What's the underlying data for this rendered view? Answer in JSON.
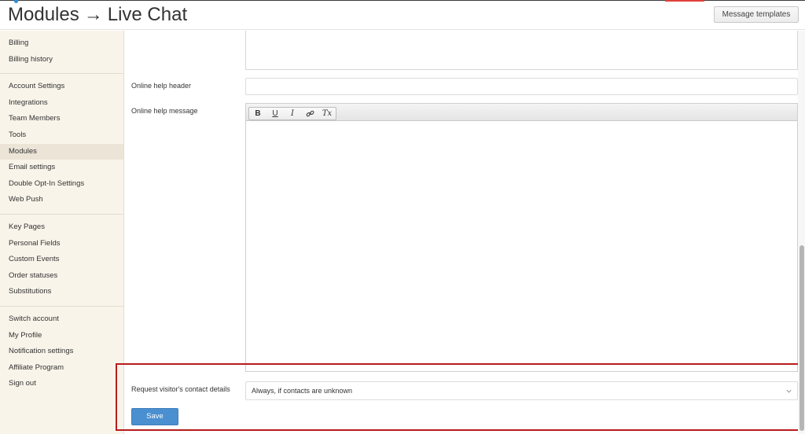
{
  "header": {
    "title_section": "Modules",
    "title_arrow": "→",
    "title_page": "Live Chat",
    "templates_button": "Message templates"
  },
  "sidebar": {
    "groups": [
      [
        "Billing",
        "Billing history"
      ],
      [
        "Account Settings",
        "Integrations",
        "Team Members",
        "Tools",
        "Modules",
        "Email settings",
        "Double Opt-In Settings",
        "Web Push"
      ],
      [
        "Key Pages",
        "Personal Fields",
        "Custom Events",
        "Order statuses",
        "Substitutions"
      ],
      [
        "Switch account",
        "My Profile",
        "Notification settings",
        "Affiliate Program",
        "Sign out"
      ]
    ],
    "active": "Modules"
  },
  "form": {
    "online_help_header_label": "Online help header",
    "online_help_header_value": "",
    "online_help_message_label": "Online help message",
    "request_contact_label": "Request visitor's contact details",
    "request_contact_value": "Always, if contacts are unknown",
    "save_label": "Save"
  },
  "toolbar": {
    "bold": "B",
    "underline": "U",
    "italic": "I",
    "link_icon": "link-icon",
    "clear_format": "Tx"
  },
  "colors": {
    "sidebar_bg": "#f9f4ea",
    "save_button": "#4a8fd0",
    "highlight_border": "#b71c1c"
  }
}
